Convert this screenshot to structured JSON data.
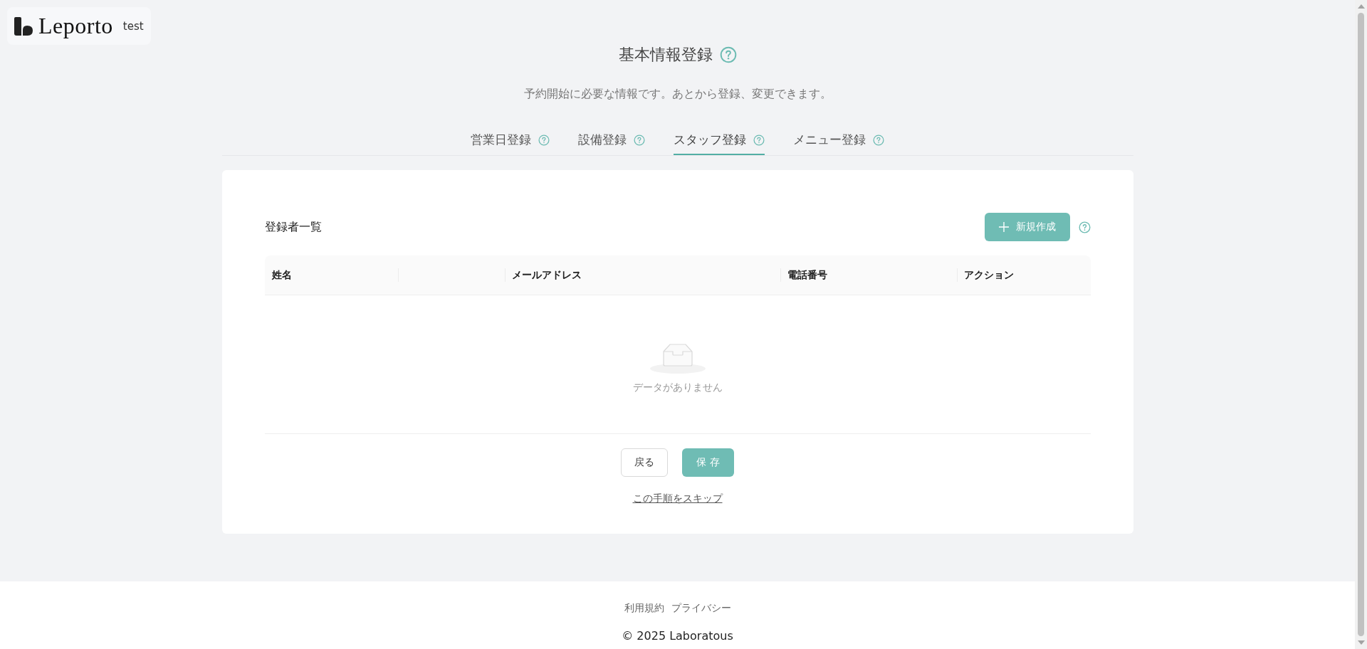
{
  "logo": {
    "name": "Leporto",
    "env": "test"
  },
  "header": {
    "title": "基本情報登録",
    "subtitle": "予約開始に必要な情報です。あとから登録、変更できます。"
  },
  "tabs": [
    {
      "label": "営業日登録",
      "selected": false
    },
    {
      "label": "設備登録",
      "selected": false
    },
    {
      "label": "スタッフ登録",
      "selected": true
    },
    {
      "label": "メニュー登録",
      "selected": false
    }
  ],
  "card": {
    "title": "登録者一覧",
    "new_button": "新規作成",
    "table": {
      "columns": [
        "姓名",
        "メールアドレス",
        "電話番号",
        "アクション"
      ],
      "empty_text": "データがありません"
    },
    "back_button": "戻る",
    "save_button": "保 存",
    "skip_link": "この手順をスキップ"
  },
  "footer": {
    "links": [
      "利用規約",
      "プライバシー"
    ],
    "copyright": "© 2025 Laboratous"
  }
}
